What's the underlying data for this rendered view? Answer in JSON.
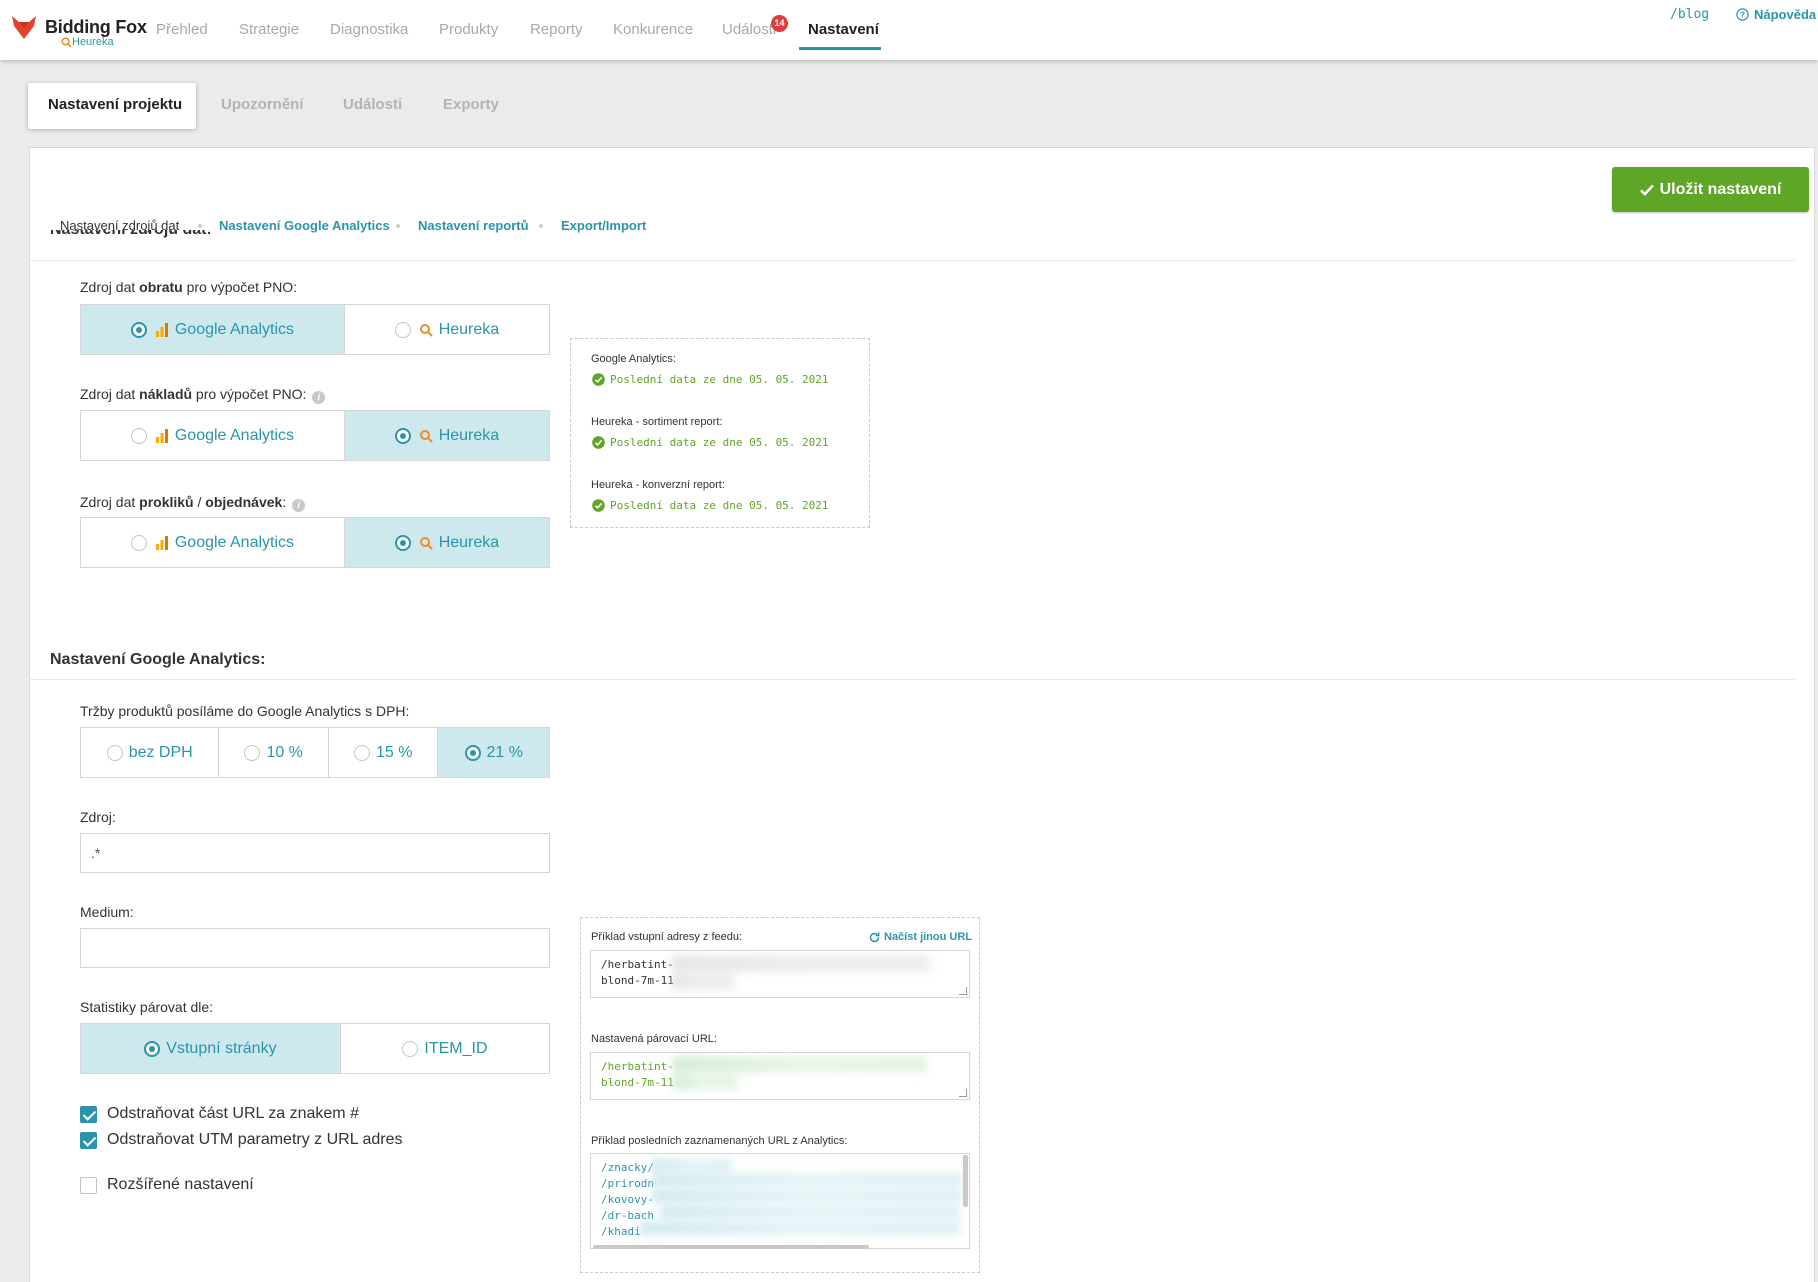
{
  "brand": {
    "title": "Bidding Fox",
    "subtitle": "Heureka"
  },
  "nav": {
    "items": [
      "Přehled",
      "Strategie",
      "Diagnostika",
      "Produkty",
      "Reporty",
      "Konkurence",
      "Události",
      "Nastavení"
    ],
    "active": "Nastavení",
    "events_badge": "14",
    "blog": "/blog",
    "help": "Nápověda"
  },
  "tabs": [
    "Nastavení projektu",
    "Upozornění",
    "Události",
    "Exporty"
  ],
  "save_button": "Uložit nastavení",
  "subnav": [
    "Nastavení zdrojů dat",
    "Nastavení Google Analytics",
    "Nastavení reportů",
    "Export/Import"
  ],
  "data_sources": {
    "heading": "Nastavení zdrojů dat:",
    "revenue": {
      "pre": "Zdroj dat ",
      "bold": "obratu",
      "post": " pro výpočet PNO:",
      "options": [
        "Google Analytics",
        "Heureka"
      ],
      "selected": "Google Analytics"
    },
    "costs": {
      "pre": "Zdroj dat ",
      "bold": "nákladů",
      "post": " pro výpočet PNO:",
      "options": [
        "Google Analytics",
        "Heureka"
      ],
      "selected": "Heureka"
    },
    "clicks": {
      "pre": "Zdroj dat ",
      "bold1": "prokliků",
      "mid": " / ",
      "bold2": "objednávek",
      "post": ":",
      "options": [
        "Google Analytics",
        "Heureka"
      ],
      "selected": "Heureka"
    },
    "status": [
      {
        "label": "Google Analytics:",
        "value": "Poslední data ze dne 05. 05. 2021"
      },
      {
        "label": "Heureka - sortiment report:",
        "value": "Poslední data ze dne 05. 05. 2021"
      },
      {
        "label": "Heureka - konverzní report:",
        "value": "Poslední data ze dne 05. 05. 2021"
      }
    ]
  },
  "ga_settings": {
    "heading": "Nastavení Google Analytics:",
    "vat_label": "Tržby produktů posíláme do Google Analytics s DPH:",
    "vat_options": [
      "bez DPH",
      "10 %",
      "15 %",
      "21 %"
    ],
    "vat_selected": "21 %",
    "source_label": "Zdroj:",
    "source_value": ".*",
    "medium_label": "Medium:",
    "medium_value": "",
    "match_label": "Statistiky párovat dle:",
    "match_options": [
      "Vstupní stránky",
      "ITEM_ID"
    ],
    "match_selected": "Vstupní stránky",
    "checkboxes": [
      {
        "label": "Odstraňovat část URL za znakem #",
        "checked": true
      },
      {
        "label": "Odstraňovat UTM parametry z URL adres",
        "checked": true
      },
      {
        "label": "Rozšířené nastavení",
        "checked": false
      }
    ]
  },
  "url_box": {
    "feed_label": "Příklad vstupní adresy z feedu:",
    "reload_link": "Načíst jinou URL",
    "feed_lines": [
      "/herbatint-",
      "blond-7m-11"
    ],
    "paired_label": "Nastavená párovací URL:",
    "paired_lines": [
      "/herbatint-",
      "blond-7m-11"
    ],
    "analytics_label": "Příklad posledních zaznamenaných URL z Analytics:",
    "analytics_lines": [
      "/znacky/",
      "/prirodn",
      "/kovovy-",
      "/dr-bach",
      "/khadi"
    ]
  },
  "colors": {
    "accent": "#2a95a8",
    "success": "#5fa526",
    "selected_bg": "#cde9ee",
    "badge": "#e23b3b"
  }
}
